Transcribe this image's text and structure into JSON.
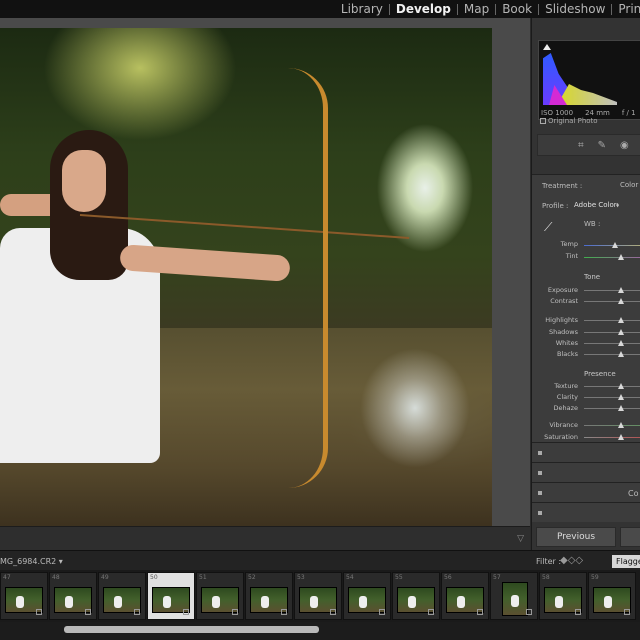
{
  "modules": [
    "Library",
    "Develop",
    "Map",
    "Book",
    "Slideshow",
    "Print"
  ],
  "active_module": "Develop",
  "histogram": {
    "iso": "ISO 1000",
    "focal": "24 mm",
    "aperture": "f / 1",
    "original_photo_label": "Original Photo"
  },
  "basic": {
    "treatment_label": "Treatment :",
    "treatment_value": "Color",
    "profile_label": "Profile :",
    "profile_value": "Adobe Color",
    "wb_label": "WB :",
    "temp_label": "Temp",
    "tint_label": "Tint",
    "tone_label": "Tone",
    "exposure_label": "Exposure",
    "contrast_label": "Contrast",
    "highlights_label": "Highlights",
    "shadows_label": "Shadows",
    "whites_label": "Whites",
    "blacks_label": "Blacks",
    "presence_label": "Presence",
    "texture_label": "Texture",
    "clarity_label": "Clarity",
    "dehaze_label": "Dehaze",
    "vibrance_label": "Vibrance",
    "saturation_label": "Saturation"
  },
  "collapsed_label": "Co",
  "buttons": {
    "previous": "Previous"
  },
  "filmstrip": {
    "filename": "MG_6984.CR2",
    "filter_label": "Filter :",
    "flagged_label": "Flagged",
    "numbers": [
      "47",
      "48",
      "49",
      "50",
      "51",
      "52",
      "53",
      "54",
      "55",
      "56",
      "57",
      "58",
      "59"
    ]
  }
}
